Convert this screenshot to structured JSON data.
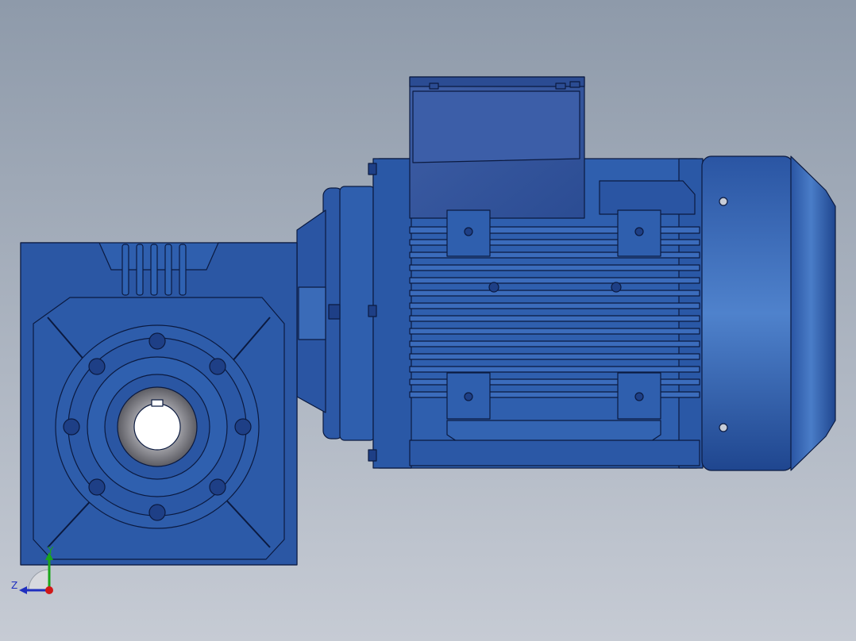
{
  "viewport": {
    "background_top": "#8e9aaa",
    "background_bottom": "#c6cbd4"
  },
  "model": {
    "body_color": "#2f5fae",
    "body_dark": "#1c3f86",
    "body_light": "#4a7dc8",
    "edge_color": "#0b1a40",
    "bore_color": "#7b7b82"
  },
  "triad": {
    "y_label": "Y",
    "z_label": "Z",
    "y_color": "#1aa51a",
    "z_color": "#1f2fbf",
    "x_color": "#d01818"
  }
}
